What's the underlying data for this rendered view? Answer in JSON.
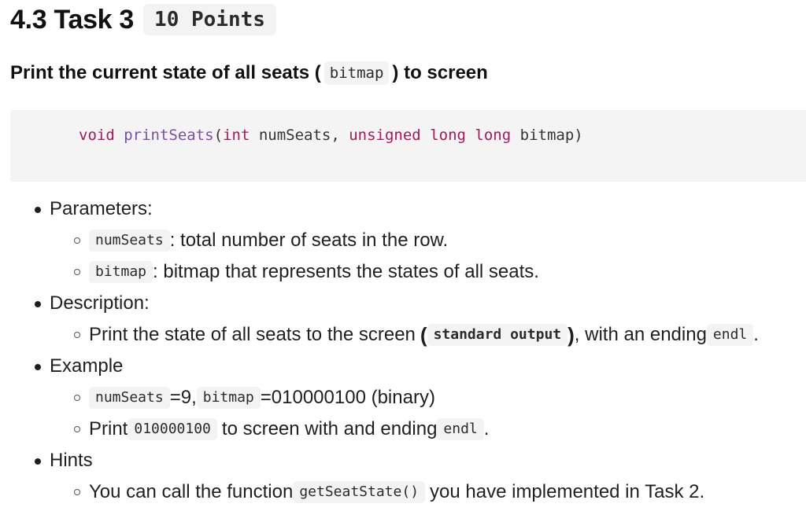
{
  "heading": {
    "title": "4.3 Task 3",
    "points_badge": "10 Points"
  },
  "subheading": {
    "before": "Print the current state of all seats (",
    "code": "bitmap",
    "after": ") to screen"
  },
  "code_block": {
    "tokens": [
      {
        "text": "void",
        "type": "keyword"
      },
      {
        "text": " ",
        "type": "plain"
      },
      {
        "text": "printSeats",
        "type": "function"
      },
      {
        "text": "(",
        "type": "plain"
      },
      {
        "text": "int",
        "type": "keyword"
      },
      {
        "text": " numSeats, ",
        "type": "plain"
      },
      {
        "text": "unsigned",
        "type": "keyword"
      },
      {
        "text": " ",
        "type": "plain"
      },
      {
        "text": "long",
        "type": "keyword"
      },
      {
        "text": " ",
        "type": "plain"
      },
      {
        "text": "long",
        "type": "keyword"
      },
      {
        "text": " bitmap)",
        "type": "plain"
      }
    ],
    "colors": {
      "keyword": "#a3185a",
      "function": "#7a4ea6",
      "plain": "#333333"
    }
  },
  "sections": {
    "parameters": {
      "label": "Parameters:",
      "items": [
        {
          "code": "numSeats",
          "text": ": total number of seats in the row."
        },
        {
          "code": "bitmap",
          "text": ": bitmap that represents the states of all seats."
        }
      ]
    },
    "description": {
      "label": "Description:",
      "item": {
        "before": "Print the state of all seats to the screen",
        "open_paren": "(",
        "code": "standard output",
        "close_paren": ")",
        "middle": ", with an ending",
        "code2": "endl",
        "after": "."
      }
    },
    "example": {
      "label": "Example",
      "line1": {
        "code1": "numSeats",
        "text1": "=9,",
        "code2": "bitmap",
        "text2": "=010000100 (binary)"
      },
      "line2": {
        "before": "Print",
        "code1": "010000100",
        "middle": "to screen with and ending",
        "code2": "endl",
        "after": "."
      }
    },
    "hints": {
      "label": "Hints",
      "item": {
        "before": "You can call the function",
        "code": "getSeatState()",
        "after": "you have implemented in Task 2."
      }
    }
  }
}
